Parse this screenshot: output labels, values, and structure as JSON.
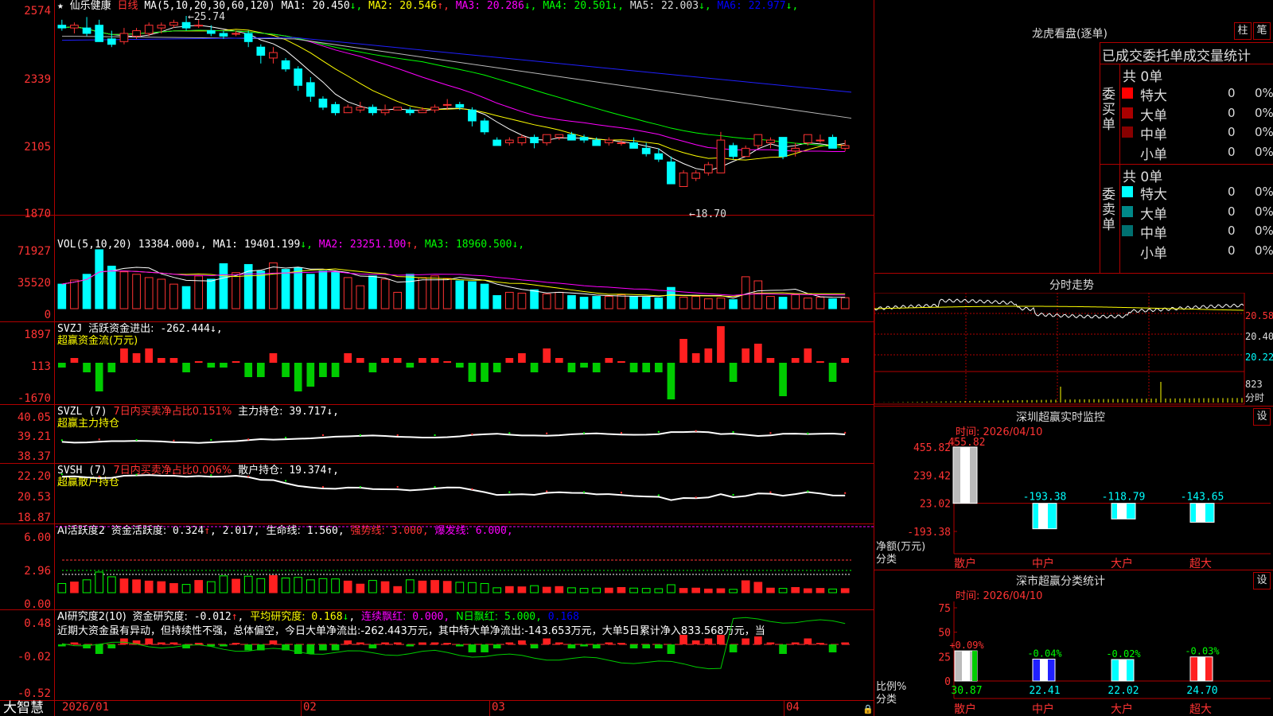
{
  "main": {
    "stock_name": "仙乐健康",
    "period": "日线",
    "ma_params": "MA(5,10,20,30,60,120)",
    "ma_values": [
      {
        "label": "MA1:",
        "value": "20.450",
        "arrow": "↓",
        "color": "#ffffff"
      },
      {
        "label": "MA2:",
        "value": "20.546",
        "arrow": "↑",
        "color": "#ffff00"
      },
      {
        "label": "MA3:",
        "value": "20.286",
        "arrow": "↓",
        "color": "#ff00ff"
      },
      {
        "label": "MA4:",
        "value": "20.501",
        "arrow": "↓",
        "color": "#00ff00"
      },
      {
        "label": "MA5:",
        "value": "22.003",
        "arrow": "↓",
        "color": "#dddddd"
      },
      {
        "label": "MA6:",
        "value": "22.977",
        "arrow": "↓",
        "color": "#0000ff"
      }
    ],
    "y_ticks": [
      "2574",
      "2339",
      "2105",
      "1870"
    ],
    "annot_high": "25.74",
    "annot_low": "18.70"
  },
  "vol": {
    "header": "VOL(5,10,20)",
    "value": "13384.000",
    "ma": [
      {
        "label": "MA1:",
        "value": "19401.199",
        "arrow": "↓",
        "color": "#ffffff"
      },
      {
        "label": "MA2:",
        "value": "23251.100",
        "arrow": "↑",
        "color": "#ff00ff"
      },
      {
        "label": "MA3:",
        "value": "18960.500",
        "arrow": "↓",
        "color": "#00ff00"
      }
    ],
    "y_ticks": [
      "71927",
      "35520",
      "0"
    ]
  },
  "svzj": {
    "header": "SVZJ",
    "label": "活跃资金进出:",
    "value": "-262.444",
    "arrow": "↓",
    "subtitle": "超赢资金流(万元)",
    "y_ticks": [
      "1897",
      "113",
      "-1670"
    ]
  },
  "svzl": {
    "header": "SVZL (7)",
    "ratio_text": "7日内买卖净占比0.151%",
    "label": "主力持仓:",
    "value": "39.717",
    "arrow": "↓",
    "subtitle": "超赢主力持仓",
    "y_ticks": [
      "40.05",
      "39.21",
      "38.37"
    ]
  },
  "svsh": {
    "header": "SVSH (7)",
    "ratio_text": "7日内买卖净占比0.006%",
    "label": "散户持仓:",
    "value": "19.374",
    "arrow": "↑",
    "subtitle": "超赢散户持仓",
    "y_ticks": [
      "22.20",
      "20.53",
      "18.87"
    ]
  },
  "ai_act": {
    "header": "AI活跃度2",
    "label": "资金活跃度:",
    "value": "0.324",
    "arrow": "↑",
    "v2": "2.017",
    "life_label": "生命线:",
    "life": "1.560",
    "strong_label": "强势线:",
    "strong": "3.000",
    "burst_label": "爆发线:",
    "burst": "6.000",
    "y_ticks": [
      "6.00",
      "2.96",
      "0.00"
    ]
  },
  "ai_res": {
    "header": "AI研究度2(10)",
    "label": "资金研究度:",
    "value": "-0.012",
    "arrow": "↑",
    "avg_label": "平均研究度:",
    "avg": "0.168",
    "avg_arrow": "↓",
    "streak_label": "连续飘红:",
    "streak": "0.000",
    "n_label": "N日飘红:",
    "n": "5.000",
    "extra": "0.168",
    "comment": "近期大资金虽有异动，但持续性不强，总体偏空，今日大单净流出:-262.443万元，其中特大单净流出:-143.653万元，大单5日累计净入833.568万元，当",
    "y_ticks": [
      "0.48",
      "-0.02",
      "-0.52"
    ]
  },
  "x_axis": {
    "labels": [
      "2026/01",
      "02",
      "03",
      "04"
    ]
  },
  "footer": {
    "brand": "大智慧"
  },
  "right": {
    "dragon": {
      "title": "龙虎看盘(逐单)",
      "btn1": "柱",
      "btn2": "笔",
      "stat_header": "已成交委托单成交量统计",
      "buy_group": "委买单",
      "sell_group": "委卖单",
      "buy_total": "共 0单",
      "sell_total": "共 0单",
      "rows": [
        {
          "name": "特大",
          "count": "0",
          "pct": "0%"
        },
        {
          "name": "大单",
          "count": "0",
          "pct": "0%"
        },
        {
          "name": "中单",
          "count": "0",
          "pct": "0%"
        },
        {
          "name": "小单",
          "count": "0",
          "pct": "0%"
        }
      ],
      "buy_colors": [
        "#ff0000",
        "#aa0000",
        "#880000",
        ""
      ],
      "sell_colors": [
        "#00ffff",
        "#008888",
        "#007070",
        ""
      ]
    },
    "minute": {
      "title": "分时走势",
      "y_ticks": [
        "20.58",
        "20.40",
        "20.22"
      ],
      "vol_tick": "823",
      "vol_label": "分时"
    },
    "monitor": {
      "title": "深圳超赢实时监控",
      "btn": "设",
      "time": "时间: 2026/04/10",
      "y_ticks": [
        "455.82",
        "239.42",
        "23.02",
        "-193.38"
      ],
      "ylabel": "净额(万元)",
      "xlabel": "分类",
      "categories": [
        "散户",
        "中户",
        "大户",
        "超大"
      ],
      "bar_labels": [
        "455.82",
        "-193.38",
        "-118.79",
        "-143.65"
      ]
    },
    "classify": {
      "title": "深市超赢分类统计",
      "btn": "设",
      "time": "时间: 2026/04/10",
      "y_ticks": [
        "75",
        "50",
        "25",
        "0"
      ],
      "ylabel": "比例%",
      "xlabel": "分类",
      "categories": [
        "散户",
        "中户",
        "大户",
        "超大"
      ],
      "top_labels": [
        "+0.09%",
        "-0.04%",
        "-0.02%",
        "-0.03%"
      ],
      "bottom_labels": [
        "30.87",
        "22.41",
        "22.02",
        "24.70"
      ]
    }
  },
  "chart_data": [
    {
      "type": "candlestick",
      "title": "仙乐健康 日线",
      "ylim": [
        18.7,
        25.74
      ],
      "y_ticks": [
        25.74,
        23.39,
        21.05,
        18.7
      ],
      "candles_ohlc": [
        [
          25.4,
          25.6,
          25.2,
          25.3
        ],
        [
          25.3,
          25.5,
          25.1,
          25.4
        ],
        [
          25.3,
          25.7,
          25.0,
          25.1
        ],
        [
          25.4,
          25.6,
          25.0,
          24.8
        ],
        [
          24.9,
          25.2,
          24.6,
          24.7
        ],
        [
          24.8,
          25.3,
          24.7,
          25.1
        ],
        [
          25.0,
          25.3,
          24.9,
          25.2
        ],
        [
          25.1,
          25.5,
          25.0,
          25.4
        ],
        [
          25.3,
          25.5,
          25.1,
          25.4
        ],
        [
          25.4,
          25.6,
          25.3,
          25.5
        ],
        [
          25.5,
          25.74,
          25.2,
          25.3
        ],
        [
          25.4,
          25.6,
          25.3,
          25.4
        ],
        [
          25.2,
          25.4,
          25.0,
          25.1
        ],
        [
          25.1,
          25.2,
          24.9,
          25.0
        ],
        [
          25.1,
          25.2,
          25.0,
          25.1
        ],
        [
          25.1,
          25.2,
          24.6,
          24.8
        ],
        [
          24.6,
          24.7,
          24.0,
          24.3
        ],
        [
          24.2,
          24.6,
          24.0,
          24.4
        ],
        [
          24.1,
          24.2,
          23.7,
          23.8
        ],
        [
          23.8,
          23.9,
          23.0,
          23.2
        ],
        [
          23.3,
          23.5,
          22.6,
          22.8
        ],
        [
          22.7,
          22.8,
          22.3,
          22.4
        ],
        [
          22.5,
          22.6,
          22.1,
          22.2
        ],
        [
          22.2,
          22.5,
          22.2,
          22.4
        ],
        [
          22.3,
          22.6,
          22.2,
          22.4
        ],
        [
          22.4,
          22.5,
          22.1,
          22.2
        ],
        [
          22.2,
          22.5,
          22.1,
          22.3
        ],
        [
          22.3,
          22.4,
          22.3,
          22.4
        ],
        [
          22.3,
          22.4,
          22.1,
          22.2
        ],
        [
          22.2,
          22.4,
          22.2,
          22.3
        ],
        [
          22.3,
          22.5,
          22.2,
          22.4
        ],
        [
          22.5,
          22.7,
          22.3,
          22.5
        ],
        [
          22.5,
          22.6,
          22.3,
          22.4
        ],
        [
          22.3,
          22.4,
          21.7,
          21.9
        ],
        [
          21.9,
          22.0,
          21.4,
          21.5
        ],
        [
          21.2,
          21.3,
          21.0,
          21.0
        ],
        [
          21.1,
          21.3,
          21.0,
          21.2
        ],
        [
          21.1,
          21.4,
          21.0,
          21.3
        ],
        [
          21.3,
          21.4,
          20.9,
          21.1
        ],
        [
          21.1,
          21.4,
          21.0,
          21.4
        ],
        [
          21.3,
          21.4,
          21.2,
          21.4
        ],
        [
          21.4,
          21.5,
          21.2,
          21.2
        ],
        [
          21.3,
          21.4,
          21.1,
          21.2
        ],
        [
          21.2,
          21.3,
          21.0,
          21.0
        ],
        [
          21.1,
          21.3,
          21.0,
          21.2
        ],
        [
          21.1,
          21.2,
          21.0,
          21.1
        ],
        [
          21.1,
          21.3,
          20.9,
          20.9
        ],
        [
          20.9,
          21.1,
          20.6,
          20.7
        ],
        [
          20.7,
          20.9,
          20.4,
          20.5
        ],
        [
          20.4,
          20.6,
          19.6,
          19.6
        ],
        [
          19.5,
          20.1,
          19.5,
          20.0
        ],
        [
          19.8,
          20.1,
          19.7,
          20.0
        ],
        [
          20.0,
          20.4,
          19.9,
          20.3
        ],
        [
          20.0,
          21.5,
          20.0,
          21.2
        ],
        [
          21.0,
          21.1,
          20.5,
          20.6
        ],
        [
          20.6,
          21.0,
          20.6,
          20.9
        ],
        [
          21.0,
          21.3,
          20.9,
          21.4
        ],
        [
          21.1,
          21.3,
          20.9,
          21.2
        ],
        [
          21.3,
          21.3,
          20.5,
          20.6
        ],
        [
          20.8,
          21.1,
          20.6,
          20.9
        ],
        [
          21.1,
          21.4,
          21.0,
          21.4
        ],
        [
          21.2,
          21.4,
          21.1,
          21.2
        ],
        [
          21.3,
          21.4,
          20.9,
          20.9
        ],
        [
          20.9,
          21.2,
          20.8,
          21.0
        ]
      ]
    },
    {
      "type": "bar",
      "title": "VOL(5,10,20)",
      "ylim": [
        0,
        71927
      ],
      "values": [
        30000,
        35000,
        42000,
        72000,
        52000,
        45000,
        42000,
        38000,
        36000,
        30000,
        27000,
        40000,
        36000,
        55000,
        44000,
        54000,
        46000,
        56000,
        48000,
        50000,
        42000,
        46000,
        45000,
        38000,
        28000,
        40000,
        36000,
        20000,
        42000,
        38000,
        40000,
        37000,
        34000,
        33000,
        30000,
        16000,
        20000,
        19000,
        23000,
        18000,
        20000,
        16000,
        14000,
        15000,
        15000,
        17000,
        15000,
        14000,
        13000,
        26000,
        14000,
        15000,
        12000,
        13000,
        11000,
        39000,
        34000,
        15000,
        14000,
        17000,
        13000,
        14000,
        12000,
        13384
      ]
    },
    {
      "type": "line",
      "title": "分时走势",
      "ylim": [
        20.22,
        20.58
      ]
    },
    {
      "type": "bar",
      "title": "深圳超赢实时监控",
      "categories": [
        "散户",
        "中户",
        "大户",
        "超大"
      ],
      "values": [
        455.82,
        -193.38,
        -118.79,
        -143.65
      ],
      "ylim": [
        -193.38,
        455.82
      ],
      "ylabel": "净额(万元)"
    },
    {
      "type": "bar",
      "title": "深市超赢分类统计",
      "categories": [
        "散户",
        "中户",
        "大户",
        "超大"
      ],
      "values": [
        30.87,
        22.41,
        22.02,
        24.7
      ],
      "changes": [
        "+0.09%",
        "-0.04%",
        "-0.02%",
        "-0.03%"
      ],
      "ylim": [
        0,
        75
      ],
      "ylabel": "比例%"
    }
  ]
}
